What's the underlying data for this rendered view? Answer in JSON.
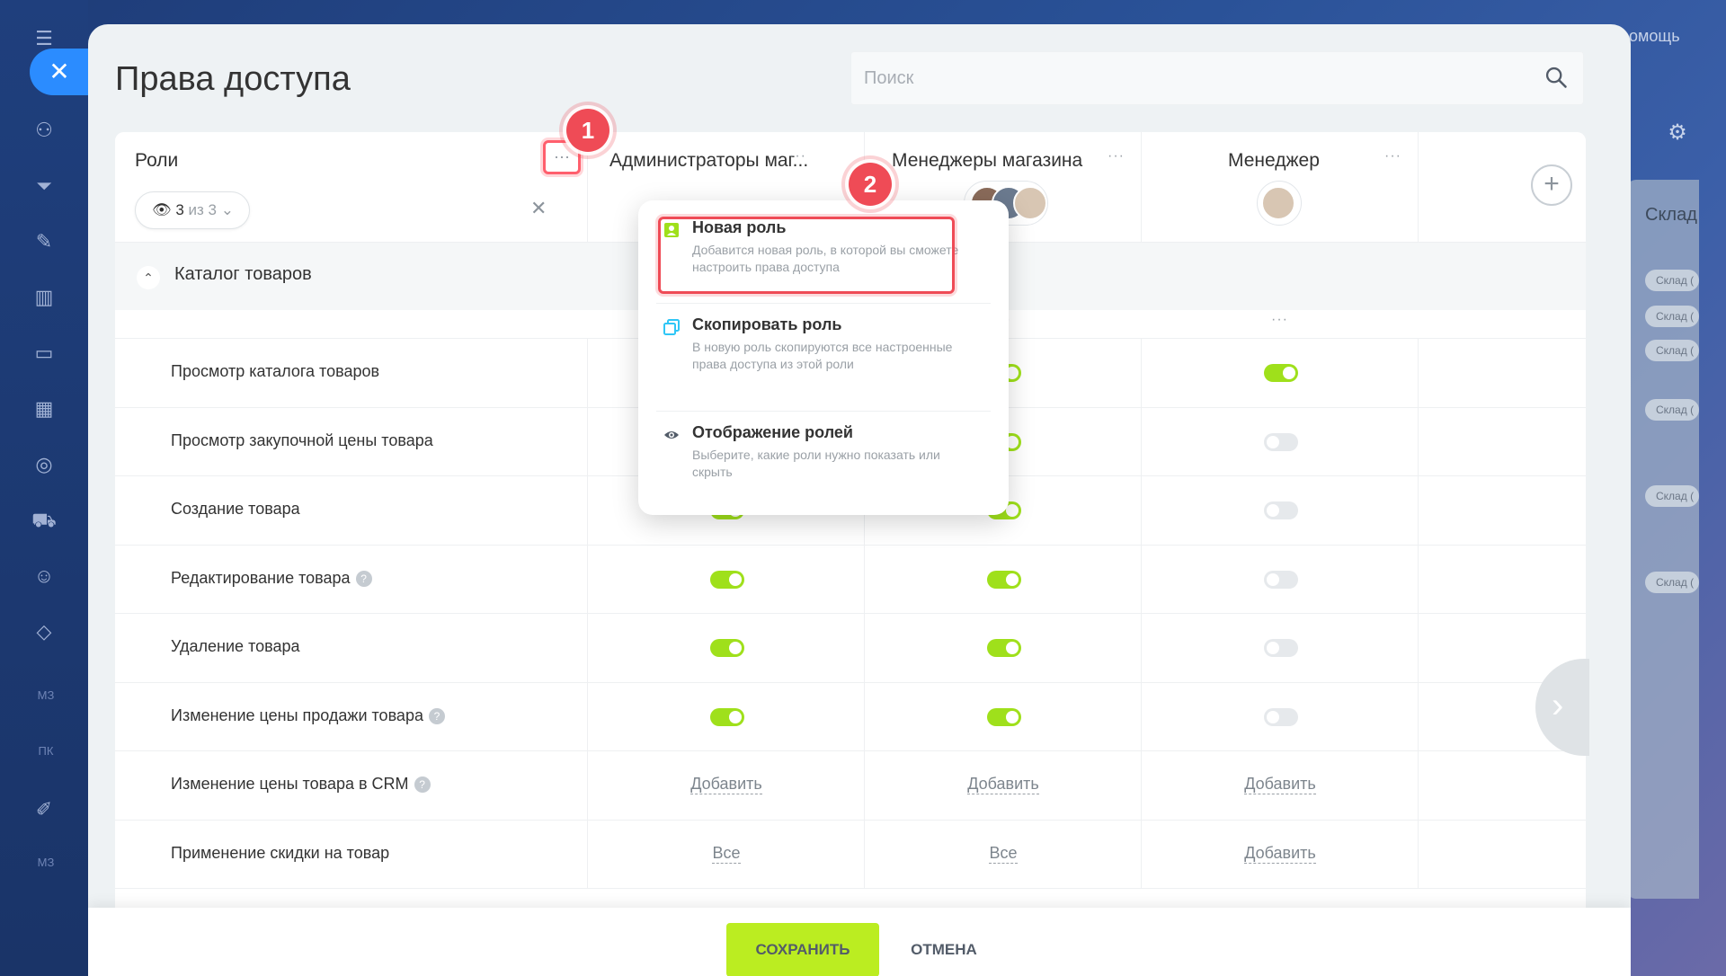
{
  "page": {
    "title": "Права доступа",
    "search_placeholder": "Поиск",
    "background_help": "омощь",
    "background_panel_label": "Склад",
    "background_chips": [
      "Склад (",
      "Склад (",
      "Склад (",
      "Склад (",
      "Склад (",
      "Склад ("
    ],
    "background_sidebar_texts": [
      "МЗ",
      "ПК",
      "МЗ"
    ]
  },
  "roles_column": {
    "label": "Роли",
    "filter_count": "3",
    "filter_rest": "из 3"
  },
  "columns": [
    {
      "title": "Администраторы маг...",
      "avatars": []
    },
    {
      "title": "Менеджеры магазина",
      "avatars": [
        "#8a6b5a",
        "#6b7a8f",
        "#d8c6b3"
      ]
    },
    {
      "title": "Менеджер",
      "avatars": [
        "#d8c6b3"
      ]
    }
  ],
  "badges": {
    "first": "1",
    "second": "2"
  },
  "section": {
    "title": "Каталог товаров"
  },
  "rows": [
    {
      "label": "Просмотр каталога товаров",
      "help": false,
      "cells": [
        "",
        "on",
        "on"
      ]
    },
    {
      "label": "Просмотр закупочной цены товара",
      "help": false,
      "cells": [
        "",
        "on",
        "off"
      ]
    },
    {
      "label": "Создание товара",
      "help": false,
      "cells": [
        "on",
        "on",
        "off"
      ]
    },
    {
      "label": "Редактирование товара",
      "help": true,
      "cells": [
        "on",
        "on",
        "off"
      ]
    },
    {
      "label": "Удаление товара",
      "help": false,
      "cells": [
        "on",
        "on",
        "off"
      ]
    },
    {
      "label": "Изменение цены продажи товара",
      "help": true,
      "cells": [
        "on",
        "on",
        "off"
      ]
    },
    {
      "label": "Изменение цены товара в CRM",
      "help": true,
      "cells": [
        "Добавить",
        "Добавить",
        "Добавить"
      ]
    },
    {
      "label": "Применение скидки на товар",
      "help": false,
      "cells": [
        "Все",
        "Все",
        "Добавить"
      ]
    }
  ],
  "menu": {
    "items": [
      {
        "title": "Новая роль",
        "desc": "Добавится новая роль, в которой вы сможете настроить права доступа",
        "icon": "user-icon",
        "color": "#9fe01b"
      },
      {
        "title": "Скопировать роль",
        "desc": "В новую роль скопируются все настроенные права доступа из этой роли",
        "icon": "copy-icon",
        "color": "#2fc6f6"
      },
      {
        "title": "Отображение ролей",
        "desc": "Выберите, какие роли нужно показать или скрыть",
        "icon": "eye-icon",
        "color": "#535c69"
      }
    ]
  },
  "footer": {
    "save_label": "СОХРАНИТЬ",
    "cancel_label": "ОТМЕНА"
  },
  "colors": {
    "accent_green": "#bbed21",
    "toggle_on": "#9fe01b",
    "badge_red": "#ef4b56",
    "primary_blue": "#2b8cff"
  }
}
